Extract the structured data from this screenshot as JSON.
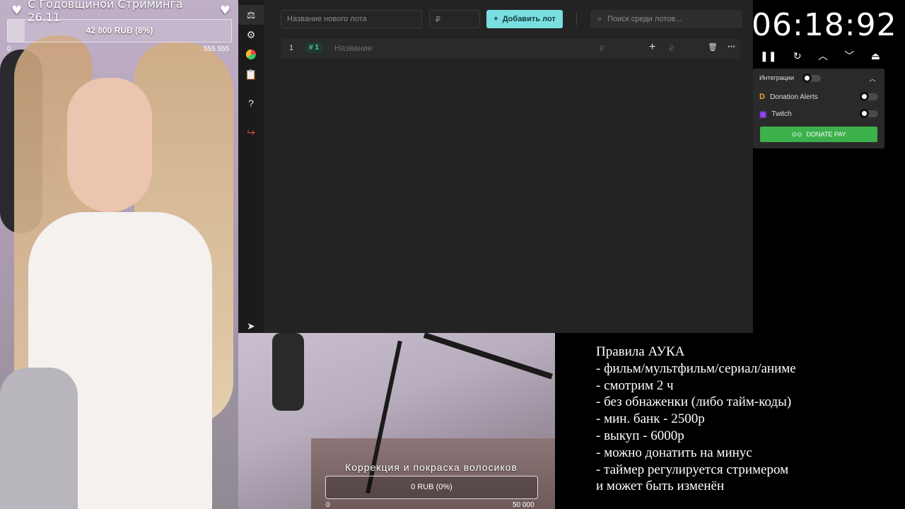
{
  "top_goal": {
    "title": "С Годовщиной Стриминга 26.11",
    "progress_label": "42 800 RUB (8%)",
    "progress_fraction": 0.077,
    "min": "0",
    "max": "555 555"
  },
  "auction": {
    "new_lot_placeholder": "Название нового лота",
    "amount_placeholder": "₽",
    "add_button": "Добавить лот",
    "search_placeholder": "Поиск среди лотов...",
    "lots": [
      {
        "index": "1",
        "tag": "# 1",
        "name": "Название",
        "amount_currency": "₽",
        "add_currency": "₽"
      }
    ]
  },
  "timer": {
    "value": "06:18:92"
  },
  "integrations": {
    "header": "Интеграции",
    "items": [
      {
        "name": "Donation Alerts",
        "icon": "donationalerts-icon"
      },
      {
        "name": "Twitch",
        "icon": "twitch-icon"
      }
    ],
    "donate_button": "DONATE PAY"
  },
  "bottom_goal": {
    "title": "Коррекция и покраска волосиков",
    "progress_label": "0 RUB (0%)",
    "progress_fraction": 0,
    "min": "0",
    "max": "50 000"
  },
  "rules": {
    "lines": [
      "Правила АУКА",
      "- фильм/мультфильм/сериал/аниме",
      "- смотрим 2 ч",
      "- без обнаженки (либо тайм-коды)",
      "- мин. банк - 2500р",
      "- выкуп - 6000р",
      "- можно донатить на минус",
      "- таймер регулируется стримером",
      "и может быть изменён"
    ]
  },
  "colors": {
    "accent_button": "#79dfe0",
    "donate_green": "#3cb04a",
    "app_bg": "#232323"
  }
}
